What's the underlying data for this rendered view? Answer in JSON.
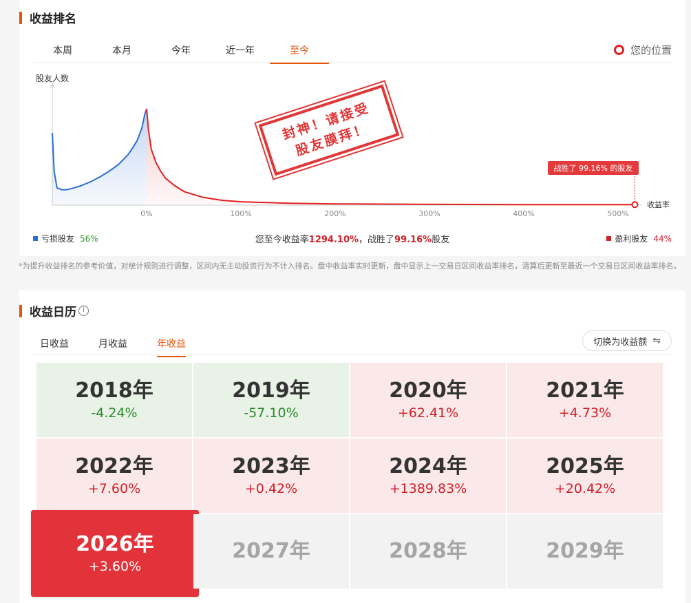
{
  "rank_section": {
    "title": "收益排名",
    "tabs": [
      {
        "label": "本周",
        "active": false
      },
      {
        "label": "本月",
        "active": false
      },
      {
        "label": "今年",
        "active": false
      },
      {
        "label": "近一年",
        "active": false
      },
      {
        "label": "至今",
        "active": true
      }
    ],
    "your_position_label": "您的位置",
    "stamp_line1": "封神！请接受",
    "stamp_line2": "股友膜拜！",
    "loss_legend": {
      "label": "亏损股友",
      "pct": "56%"
    },
    "profit_legend": {
      "label": "盈利股友",
      "pct": "44%"
    },
    "summary": {
      "prefix": "您至今收益率",
      "rate": "1294.10%",
      "mid": "，战胜了",
      "beat": "99.16%",
      "suffix": "股友"
    },
    "footnote": "*为提升收益排名的参考价值，对统计规则进行调整，区间内无主动投资行为不计入排名。盘中收益率实时更新，盘中显示上一交易日区间收益率排名，清算后更新至最近一个交易日区间收益率排名。"
  },
  "chart_data": {
    "type": "area",
    "ylabel": "股友人数",
    "xlabel": "收益率",
    "x_ticks": [
      "0%",
      "100%",
      "200%",
      "300%",
      "400%",
      "500%"
    ],
    "xlim": [
      -100,
      520
    ],
    "grid": false,
    "series": [
      {
        "name": "亏损股友",
        "color": "#2b6fd6",
        "x": [
          -100,
          -98,
          -95,
          -90,
          -85,
          -80,
          -70,
          -60,
          -50,
          -40,
          -30,
          -20,
          -15,
          -10,
          -5,
          -2,
          0
        ],
        "y": [
          0.75,
          0.35,
          0.18,
          0.16,
          0.16,
          0.17,
          0.2,
          0.24,
          0.29,
          0.35,
          0.42,
          0.52,
          0.59,
          0.67,
          0.8,
          0.94,
          1.0
        ]
      },
      {
        "name": "盈利股友",
        "color": "#e02020",
        "x": [
          0,
          2,
          5,
          10,
          15,
          20,
          30,
          40,
          60,
          80,
          100,
          150,
          200,
          300,
          400,
          500,
          520
        ],
        "y": [
          1.0,
          0.78,
          0.58,
          0.44,
          0.35,
          0.28,
          0.2,
          0.14,
          0.08,
          0.05,
          0.035,
          0.02,
          0.013,
          0.008,
          0.006,
          0.005,
          0.005
        ]
      }
    ],
    "marker": {
      "label": "战胜了 99.16% 的股友",
      "x": 520,
      "y": 0.005
    }
  },
  "calendar_section": {
    "title": "收益日历",
    "info_icon": "ⓘ",
    "tabs": [
      {
        "label": "日收益",
        "active": false
      },
      {
        "label": "月收益",
        "active": false
      },
      {
        "label": "年收益",
        "active": true
      }
    ],
    "switch_label": "切换为收益额",
    "switch_icon": "⇋",
    "years": [
      {
        "year": "2018年",
        "value": "-4.24%",
        "state": "neg"
      },
      {
        "year": "2019年",
        "value": "-57.10%",
        "state": "neg"
      },
      {
        "year": "2020年",
        "value": "+62.41%",
        "state": "pos"
      },
      {
        "year": "2021年",
        "value": "+4.73%",
        "state": "pos"
      },
      {
        "year": "2022年",
        "value": "+7.60%",
        "state": "pos"
      },
      {
        "year": "2023年",
        "value": "+0.42%",
        "state": "pos"
      },
      {
        "year": "2024年",
        "value": "+1389.83%",
        "state": "pos"
      },
      {
        "year": "2025年",
        "value": "+20.42%",
        "state": "pos"
      },
      {
        "year": "2026年",
        "value": "+3.60%",
        "state": "current"
      },
      {
        "year": "2027年",
        "value": "",
        "state": "none"
      },
      {
        "year": "2028年",
        "value": "",
        "state": "none"
      },
      {
        "year": "2029年",
        "value": "",
        "state": "none"
      }
    ]
  }
}
